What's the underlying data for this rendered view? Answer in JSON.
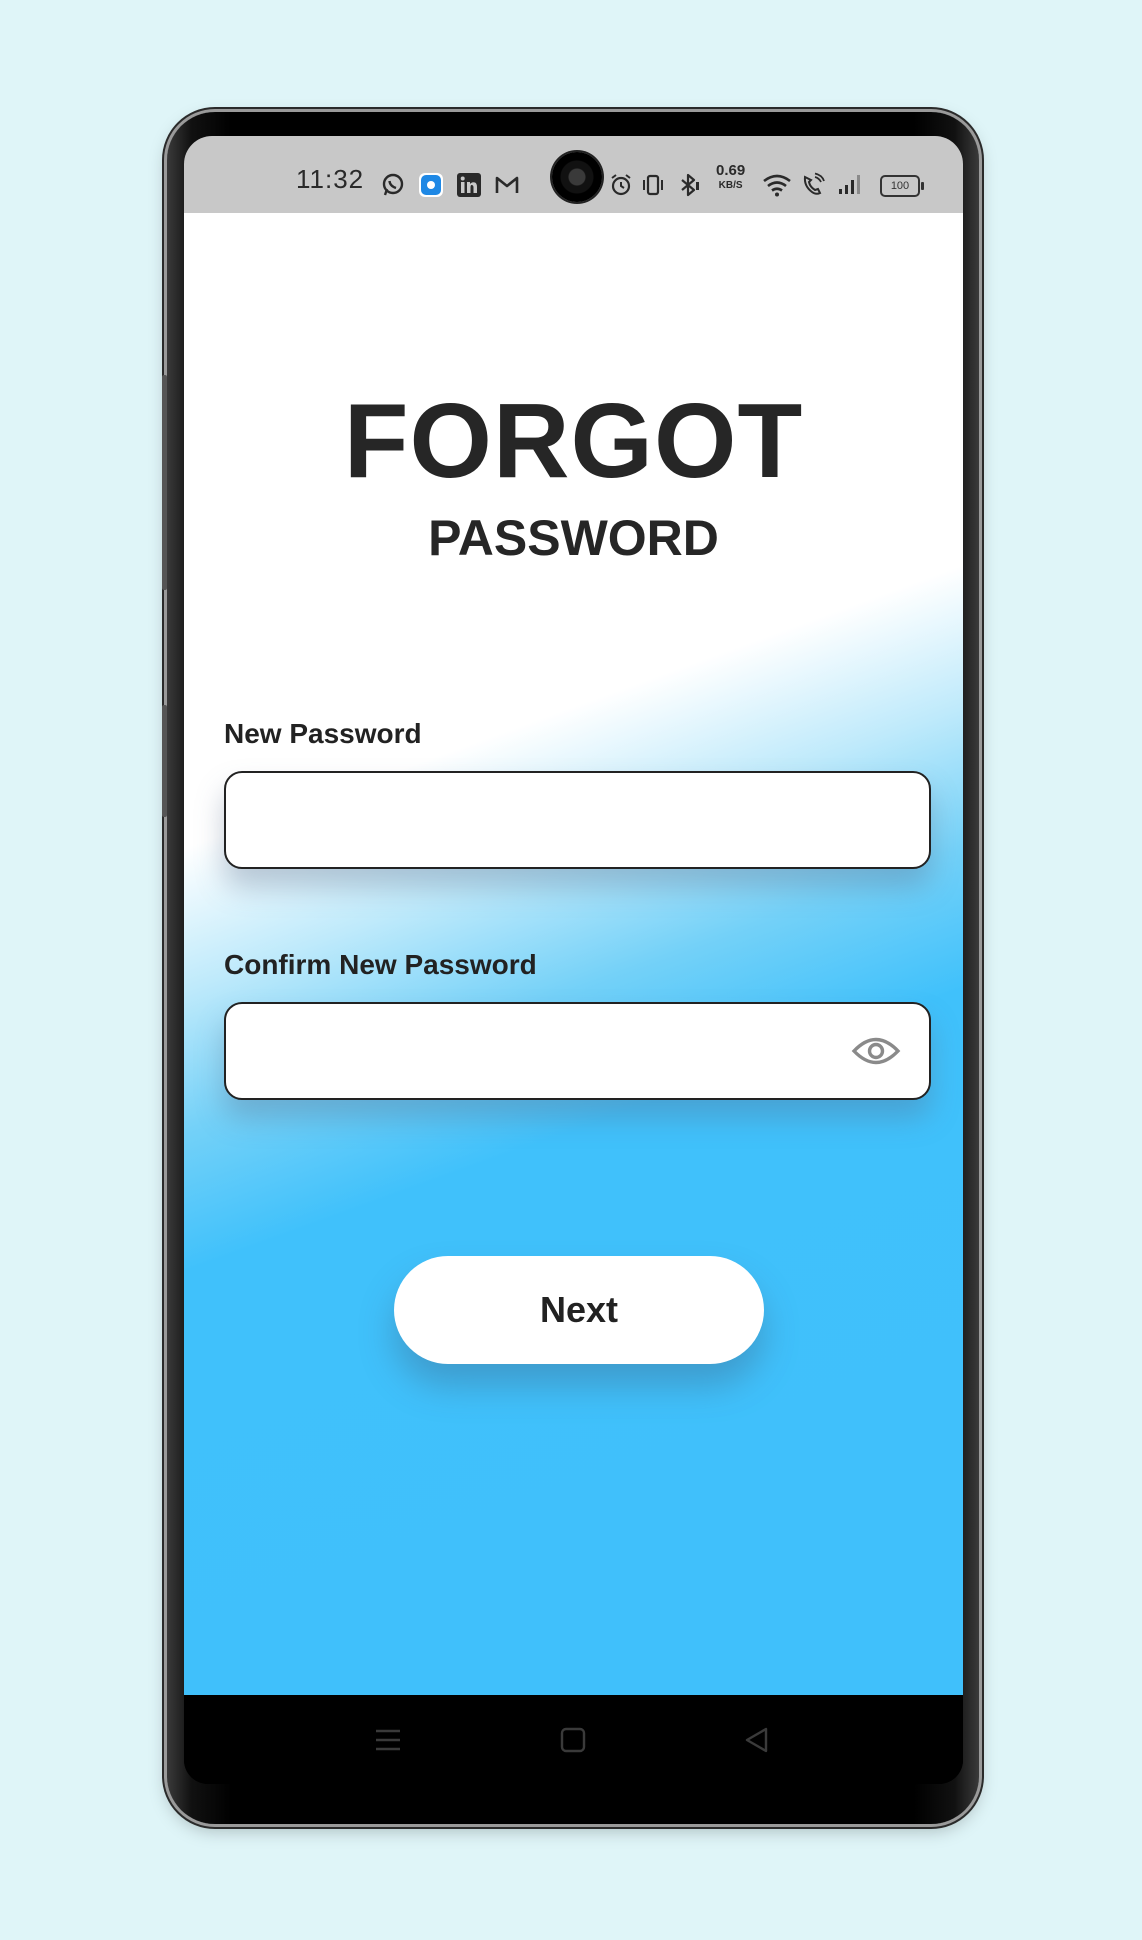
{
  "status_bar": {
    "time": "11:32",
    "net_speed_value": "0.69",
    "net_speed_unit": "KB/S",
    "battery": "100",
    "icons": [
      "whatsapp-icon",
      "app-notification-icon",
      "linkedin-icon",
      "gmail-icon",
      "alarm-icon",
      "vibrate-icon",
      "bluetooth-icon",
      "wifi-icon",
      "volte-call-icon",
      "signal-icon",
      "battery-icon"
    ]
  },
  "screen": {
    "title_main": "FORGOT",
    "title_sub": "PASSWORD",
    "new_password": {
      "label": "New Password",
      "value": ""
    },
    "confirm_password": {
      "label": "Confirm New Password",
      "value": "",
      "toggle_icon": "eye-icon"
    },
    "next_label": "Next"
  },
  "navigation": {
    "icons": [
      "menu-icon",
      "home-icon",
      "back-icon"
    ]
  },
  "colors": {
    "background": "#dff5f8",
    "accent_blue": "#40c1fb",
    "text_dark": "#262626",
    "status_bar": "#c8c8c8"
  }
}
